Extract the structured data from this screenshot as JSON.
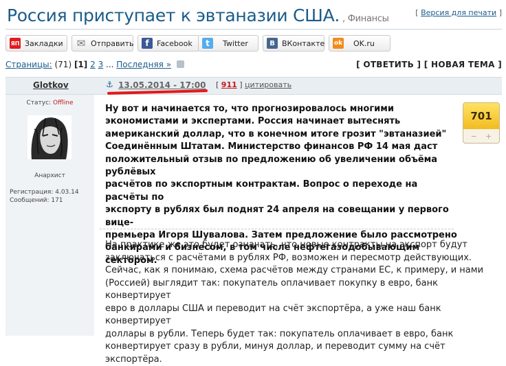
{
  "header": {
    "title": "Россия приступает к эвтаназии США.",
    "category": ", Финансы",
    "print_prefix": "[ ",
    "print_link": "Версия для печати",
    "print_suffix": " ]"
  },
  "share": {
    "buttons": [
      {
        "label": "Закладки",
        "icon": "yandex-bookmarks-icon",
        "color": "#e21b1b",
        "glyph": "ЯП"
      },
      {
        "label": "Отправить",
        "icon": "mail-icon",
        "color": "#8a8a8a",
        "glyph": "✉"
      },
      {
        "label": "Facebook",
        "icon": "facebook-icon",
        "color": "#3b5998",
        "glyph": "f"
      },
      {
        "label": "Twitter",
        "icon": "twitter-icon",
        "color": "#55acee",
        "glyph": "t"
      },
      {
        "label": "ВКонтакте",
        "icon": "vkontakte-icon",
        "color": "#45668e",
        "glyph": "В"
      },
      {
        "label": "OK.ru",
        "icon": "odnoklassniki-icon",
        "color": "#f28a19",
        "glyph": "ok"
      }
    ]
  },
  "nav": {
    "pages_label": "Страницы:",
    "pages_count": " (71) ",
    "current_page": "[1]",
    "page_2": "2",
    "page_3": "3",
    "ellipsis": " ... ",
    "last_link": "Последняя »",
    "reply": "[ ОТВЕТИТЬ ]",
    "new_topic": "[ НОВАЯ ТЕМА ]"
  },
  "post": {
    "author": "Glotkov",
    "date": "13.05.2014 - 17:00",
    "links_prefix": "[ ",
    "number": "911",
    "links_sep": " ] ",
    "cite": "цитировать",
    "status_label": "Статус: ",
    "status_value": "Offline",
    "rank": "Анархист",
    "registration": "Регистрация: 4.03.14",
    "messages": "Сообщений: 171",
    "rating": "701",
    "rating_minus": "−",
    "rating_plus": "+",
    "bold_lines": [
      "Ну вот и начинается то, что прогнозировалось многими",
      "экономистами и экспертами. Россия начинает вытеснять",
      "американский доллар, что в конечном итоге грозит \"эвтаназией\"",
      "Соединённым Штатам. Министерство финансов РФ 14 мая даст",
      "положительный отзыв по предложению об увеличении объёма рублёвых",
      "расчётов по экспортным контрактам. Вопрос о переходе на расчёты по",
      "экспорту в рублях был поднят 24 апреля на совещании у первого вице-",
      "премьера Игоря Шувалова. Затем предложение было рассмотрено",
      "банкирами и бизнесом, в том числе нефтегазодобывающим сектором."
    ],
    "normal_lines": [
      "На практике же это будет означать, что новые контракты на экспорт будут",
      "заключаться с расчётами в рублях РФ, возможен и пересмотр действующих.",
      "Сейчас, как я понимаю, схема расчётов между странами ЕС, к примеру, и нами",
      "(Россией) выглядит так: покупатель оплачивает покупку в евро, банк конвертирует",
      "евро в доллары США и переводит на счёт экспортёра, а уже наш банк конвертирует",
      "доллары в рубли. Теперь будет так: покупатель оплачивает в евро, банк",
      "конвертирует сразу в рубли, минуя доллар, и переводит сумму на счёт экспортёра."
    ]
  },
  "colors": {
    "title": "#1a5c8a",
    "accent_red": "#e01a1a",
    "side_bg": "#eff3f6",
    "rating_gold": "#f2bb21"
  }
}
